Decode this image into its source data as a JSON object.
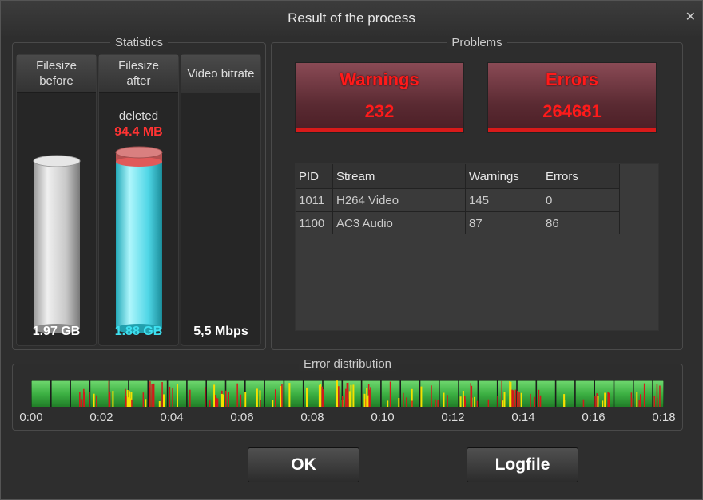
{
  "window": {
    "title": "Result of the process"
  },
  "statistics": {
    "title": "Statistics",
    "columns": [
      {
        "header": "Filesize before",
        "value": "1.97 GB"
      },
      {
        "header": "Filesize after",
        "value": "1.88 GB",
        "deleted_label": "deleted",
        "deleted_value": "94.4 MB"
      },
      {
        "header": "Video bitrate",
        "value": "5,5 Mbps"
      }
    ]
  },
  "problems": {
    "title": "Problems",
    "warnings_label": "Warnings",
    "warnings_count": "232",
    "errors_label": "Errors",
    "errors_count": "264681",
    "table": {
      "headers": [
        "PID",
        "Stream",
        "Warnings",
        "Errors"
      ],
      "rows": [
        [
          "1011",
          "H264 Video",
          "145",
          "0"
        ],
        [
          "1100",
          "AC3 Audio",
          "87",
          "86"
        ]
      ]
    }
  },
  "error_distribution": {
    "title": "Error distribution",
    "ticks": [
      "0:00",
      "0:02",
      "0:04",
      "0:06",
      "0:08",
      "0:10",
      "0:12",
      "0:14",
      "0:16",
      "0:18"
    ]
  },
  "buttons": {
    "ok": "OK",
    "logfile": "Logfile"
  },
  "colors": {
    "accent_red": "#ff1a1a",
    "cyan": "#3ee0f0",
    "green": "#3cb043"
  }
}
